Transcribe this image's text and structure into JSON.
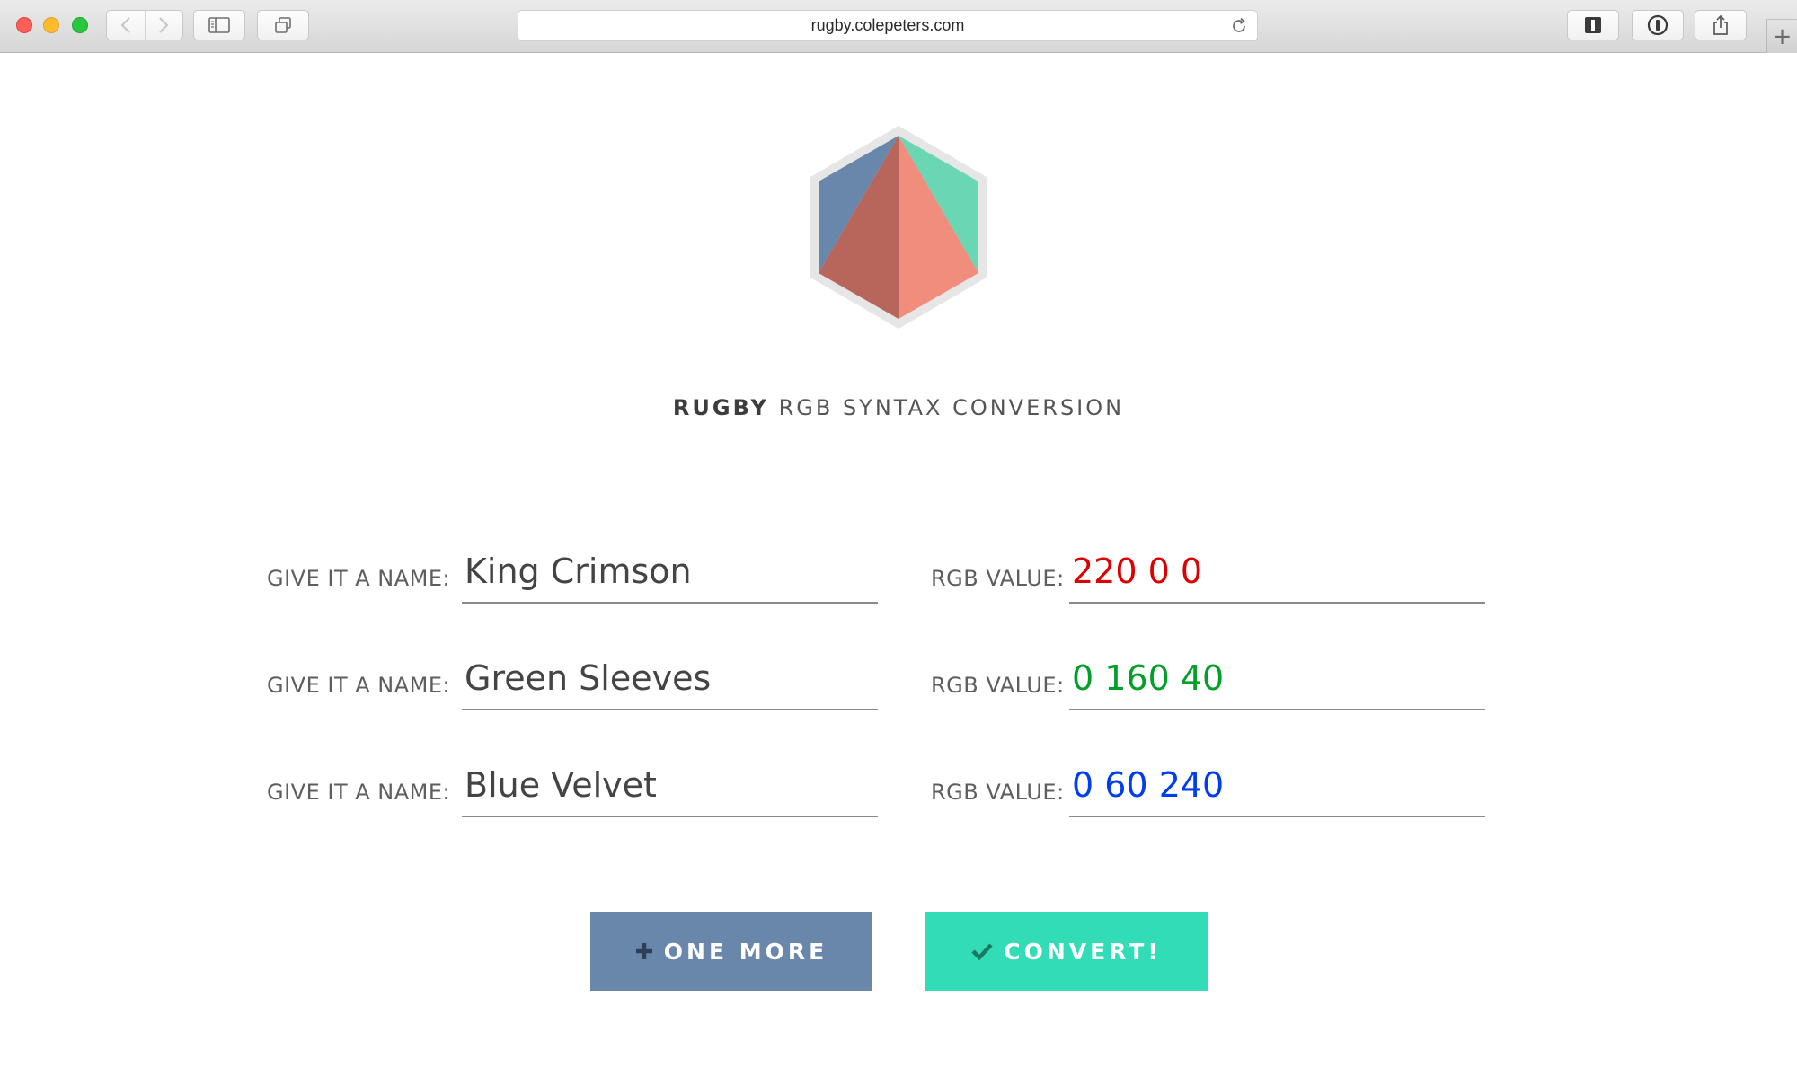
{
  "browser": {
    "url": "rugby.colepeters.com",
    "icons": {
      "back": "chevron-left-icon",
      "forward": "chevron-right-icon",
      "sidebar": "sidebar-icon",
      "tabs": "tabs-overview-icon",
      "reload": "reload-icon",
      "reader": "reader-icon",
      "password": "password-manager-icon",
      "share": "share-icon",
      "new_tab": "plus-icon"
    }
  },
  "logo": {
    "colors": {
      "outline": "#e6e6e6",
      "left": "#6986ab",
      "right": "#6bd6b3",
      "front_left": "#b8665b",
      "front_right": "#f08d7d"
    }
  },
  "header": {
    "brand": "RUGBY",
    "subtitle": "RGB SYNTAX CONVERSION"
  },
  "rows": [
    {
      "name_label": "GIVE IT A NAME:",
      "name": "King Crimson",
      "rgb_label": "RGB VALUE:",
      "rgb": "220 0 0",
      "rgb_color": "#dc0000"
    },
    {
      "name_label": "GIVE IT A NAME:",
      "name": "Green Sleeves",
      "rgb_label": "RGB VALUE:",
      "rgb": "0 160 40",
      "rgb_color": "#00a028"
    },
    {
      "name_label": "GIVE IT A NAME:",
      "name": "Blue Velvet",
      "rgb_label": "RGB VALUE:",
      "rgb": "0 60 240",
      "rgb_color": "#003cf0"
    }
  ],
  "buttons": {
    "one_more": {
      "label": "ONE MORE",
      "icon": "plus-icon",
      "color": "#6986ab"
    },
    "convert": {
      "label": "CONVERT!",
      "icon": "checkmark-icon",
      "color": "#32dcb6"
    }
  }
}
